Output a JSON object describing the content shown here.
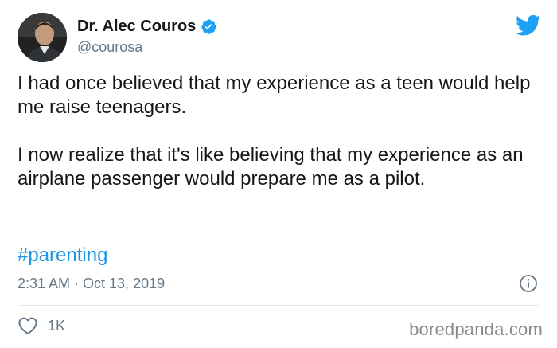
{
  "author": {
    "display_name": "Dr. Alec Couros",
    "handle": "@courosa",
    "verified_icon": "verified-badge-icon"
  },
  "tweet": {
    "paragraphs": [
      "I had once believed that my experience as a teen would help me raise teenagers.",
      "I now realize that it's like believing that my experience as an airplane passenger would prepare me as a pilot."
    ],
    "hashtag": "#parenting",
    "timestamp": "2:31 AM · Oct 13, 2019"
  },
  "actions": {
    "like_count": "1K",
    "like_icon": "heart-icon",
    "info_icon": "info-icon"
  },
  "brand": {
    "logo_icon": "twitter-bird-icon",
    "watermark": "boredpanda.com"
  },
  "colors": {
    "text": "#14171a",
    "secondary": "#657786",
    "accent": "#1da1f2",
    "link": "#1b95e0",
    "divider": "#e1e8ed",
    "watermark": "#8a8a8a"
  }
}
